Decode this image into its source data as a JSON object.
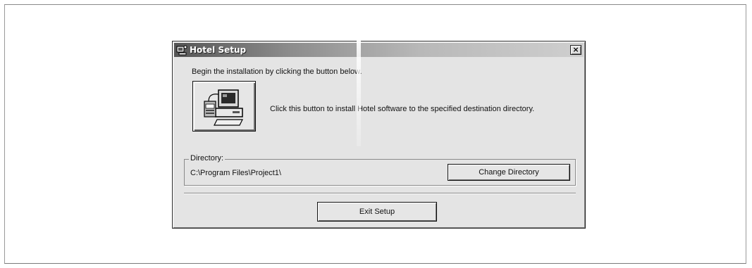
{
  "window": {
    "title": "Hotel Setup",
    "close_label": "×"
  },
  "intro": {
    "text": "Begin the installation by clicking the button below."
  },
  "install": {
    "icon": "computer-setup-icon",
    "description": "Click this button to install Hotel software to the specified destination directory."
  },
  "directory": {
    "legend": "Directory:",
    "path": "C:\\Program Files\\Project1\\",
    "change_button_label": "Change Directory"
  },
  "footer": {
    "exit_button_label": "Exit Setup"
  },
  "colors": {
    "dialog_bg": "#e4e4e4",
    "titlebar_dark": "#555555",
    "titlebar_light": "#cfcfcf"
  }
}
